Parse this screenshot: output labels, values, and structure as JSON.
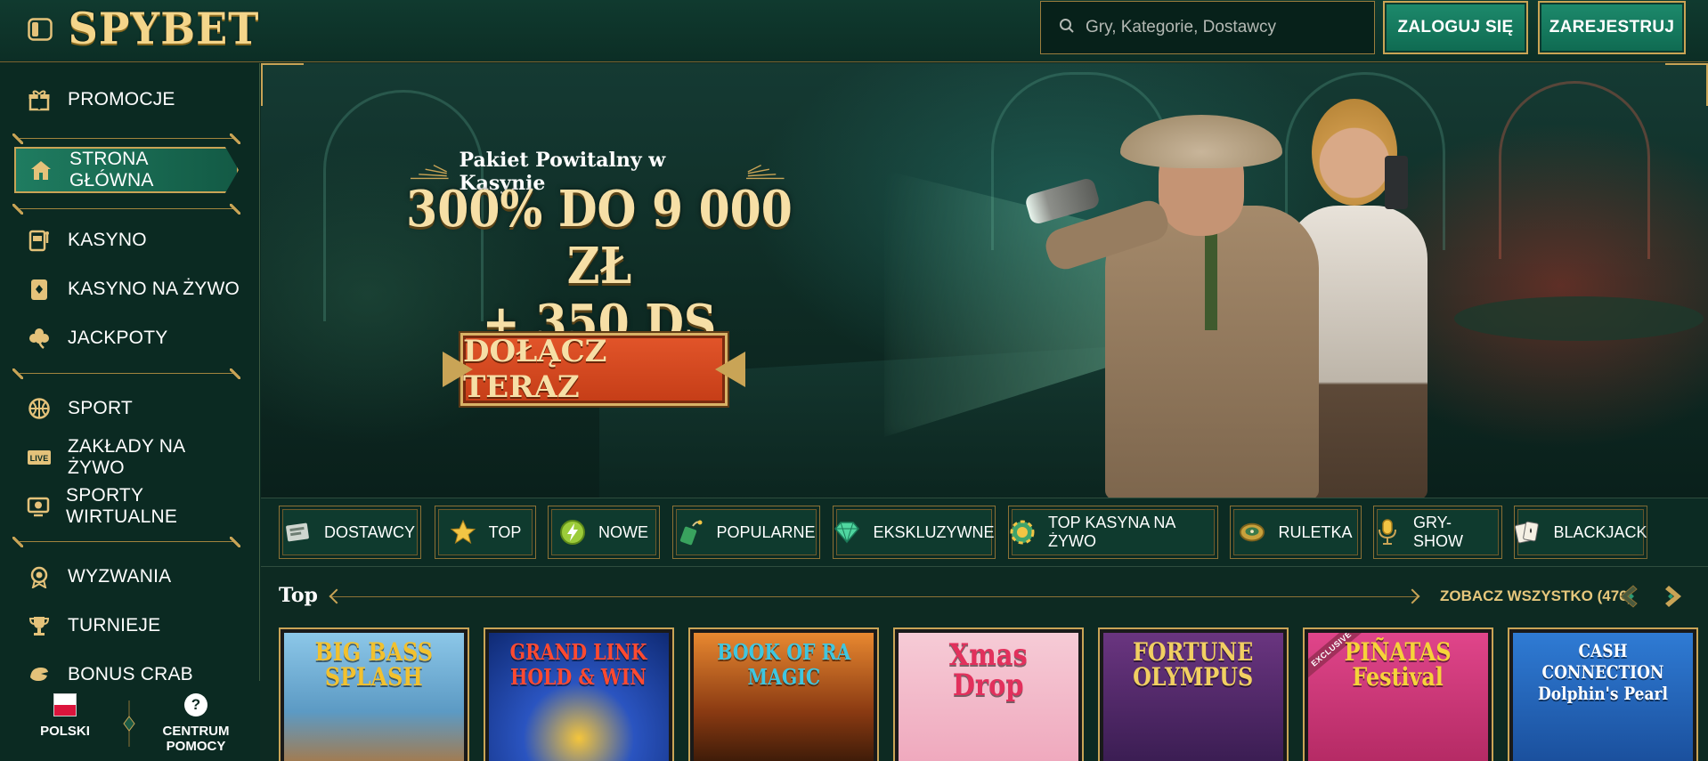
{
  "header": {
    "logo": "SPYBET",
    "search_placeholder": "Gry, Kategorie, Dostawcy",
    "login_label": "ZALOGUJ SIĘ",
    "register_label": "ZAREJESTRUJ"
  },
  "sidebar": {
    "items": [
      {
        "label": "PROMOCJE",
        "icon": "gift-icon"
      },
      {
        "label": "STRONA GŁÓWNA",
        "icon": "home-icon",
        "active": true
      },
      {
        "label": "KASYNO",
        "icon": "slot-machine-icon"
      },
      {
        "label": "KASYNO NA ŻYWO",
        "icon": "playing-card-icon"
      },
      {
        "label": "JACKPOTY",
        "icon": "clover-icon"
      },
      {
        "label": "SPORT",
        "icon": "basketball-icon"
      },
      {
        "label": "ZAKŁADY NA ŻYWO",
        "icon": "live-badge-icon"
      },
      {
        "label": "SPORTY WIRTUALNE",
        "icon": "virtual-sport-icon"
      },
      {
        "label": "WYZWANIA",
        "icon": "medal-icon"
      },
      {
        "label": "TURNIEJE",
        "icon": "trophy-icon"
      },
      {
        "label": "BONUS CRAB",
        "icon": "crab-claw-icon"
      }
    ],
    "footer": {
      "language_label": "POLSKI",
      "help_label": "CENTRUM POMOCY",
      "help_icon_glyph": "?"
    }
  },
  "hero": {
    "subtitle": "Pakiet Powitalny w Kasynie",
    "title_line1": "300% DO 9 000 ZŁ",
    "title_line2": "+ 350 DS",
    "cta_label": "DOŁĄCZ TERAZ"
  },
  "categories": [
    {
      "label": "DOSTAWCY",
      "icon": "providers-icon"
    },
    {
      "label": "TOP",
      "icon": "star-icon"
    },
    {
      "label": "NOWE",
      "icon": "lightning-icon"
    },
    {
      "label": "POPULARNE",
      "icon": "dynamite-icon"
    },
    {
      "label": "EKSKLUZYWNE",
      "icon": "diamond-icon"
    },
    {
      "label": "TOP KASYNA NA ŻYWO",
      "icon": "chip-icon"
    },
    {
      "label": "RULETKA",
      "icon": "roulette-icon"
    },
    {
      "label": "GRY-SHOW",
      "icon": "microphone-icon"
    },
    {
      "label": "BLACKJACK",
      "icon": "cards-icon"
    }
  ],
  "top_section": {
    "title": "Top",
    "see_all_label": "ZOBACZ WSZYSTKO (476)"
  },
  "games": [
    {
      "title": "BIG BASS\nSPLASH",
      "bg": "#6fb3d9",
      "fg": "#f2c12e"
    },
    {
      "title": "GRAND LINK\nHOLD & WIN",
      "bg": "#1b3f9a",
      "fg": "#e8382e"
    },
    {
      "title": "BOOK OF RA\nMAGIC",
      "bg": "#7a3a10",
      "fg": "#3ec6e0"
    },
    {
      "title": "Xmas\nDrop",
      "bg": "#f0b7c6",
      "fg": "#e2305c"
    },
    {
      "title": "FORTUNE\nOLYMPUS",
      "bg": "#5a2d6e",
      "fg": "#f1cf62"
    },
    {
      "title": "PIÑATAS\nFestival",
      "bg": "#d6357a",
      "fg": "#f6d33a",
      "badge": "EXCLUSIVE"
    },
    {
      "title": "CASH CONNECTION\nDolphin's Pearl",
      "bg": "#1a5fb0",
      "fg": "#ffffff"
    }
  ],
  "colors": {
    "gold": "#c9a456",
    "green_bg": "#0d2a22",
    "button_green": "#1d8a6c",
    "cta_orange": "#e2552a"
  }
}
